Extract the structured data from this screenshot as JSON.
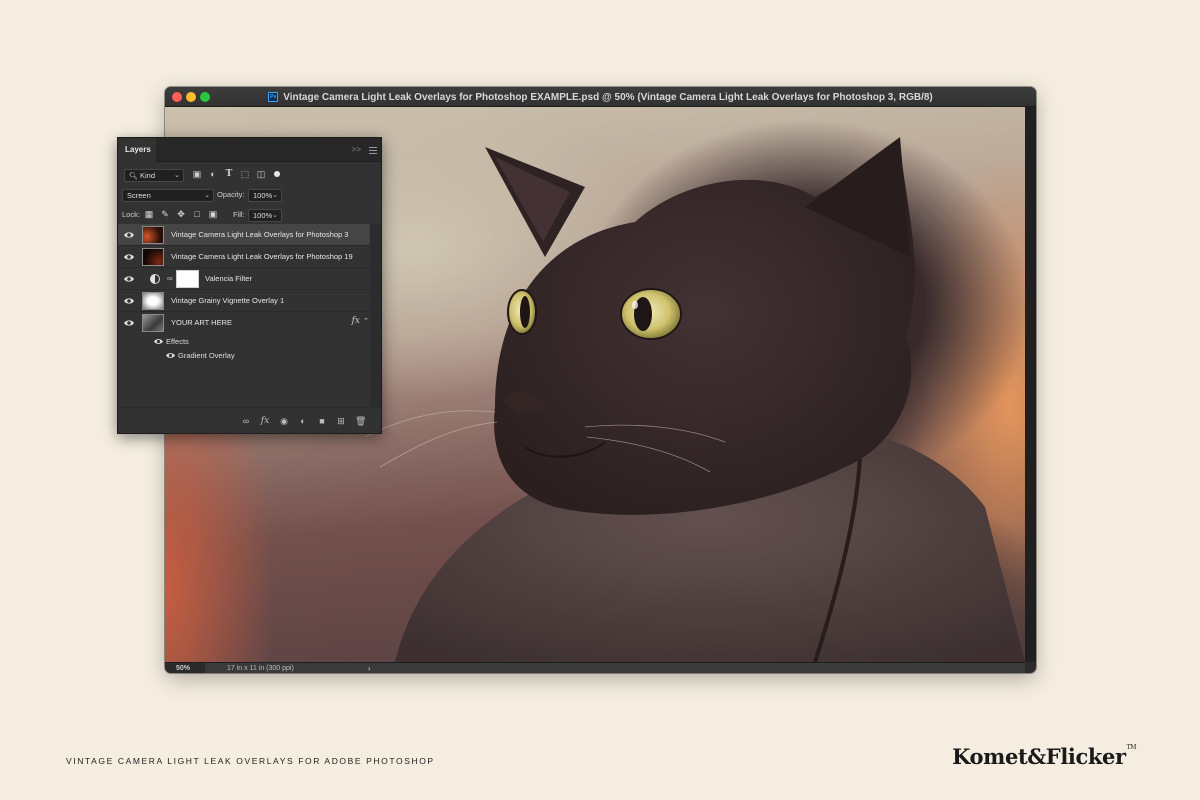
{
  "window": {
    "title": "Vintage Camera Light Leak Overlays for Photoshop EXAMPLE.psd @ 50% (Vintage Camera Light Leak Overlays for Photoshop 3, RGB/8)",
    "app_icon_text": "Ps"
  },
  "statusbar": {
    "zoom": "50%",
    "doc_info": "17 in x 11 in (300 ppi)",
    "arrow": "›"
  },
  "layers_panel": {
    "tab_label": "Layers",
    "collapse_glyph": ">>",
    "filter": {
      "kind_label": "Kind",
      "kind_icon": "search-icon"
    },
    "blend_mode": "Screen",
    "opacity_label": "Opacity:",
    "opacity_value": "100%",
    "lock_label": "Lock:",
    "fill_label": "Fill:",
    "fill_value": "100%",
    "layers": [
      {
        "name": "Vintage Camera Light Leak Overlays for Photoshop 3",
        "selected": true
      },
      {
        "name": "Vintage Camera Light Leak Overlays for Photoshop 19",
        "selected": false
      },
      {
        "name": "Valencia Filter",
        "selected": false
      },
      {
        "name": "Vintage Grainy Vignette Overlay 1",
        "selected": false
      },
      {
        "name": "YOUR ART HERE",
        "selected": false,
        "fx": "fx"
      }
    ],
    "effects_label": "Effects",
    "effect_items": [
      "Gradient Overlay"
    ]
  },
  "caption": "VINTAGE CAMERA LIGHT LEAK OVERLAYS FOR ADOBE PHOTOSHOP",
  "brand": {
    "name": "Komet&Flicker",
    "tm": "TM"
  },
  "colors": {
    "page_bg": "#f5eee0",
    "panel_bg": "#323232",
    "titlebar_bg": "#383838"
  }
}
